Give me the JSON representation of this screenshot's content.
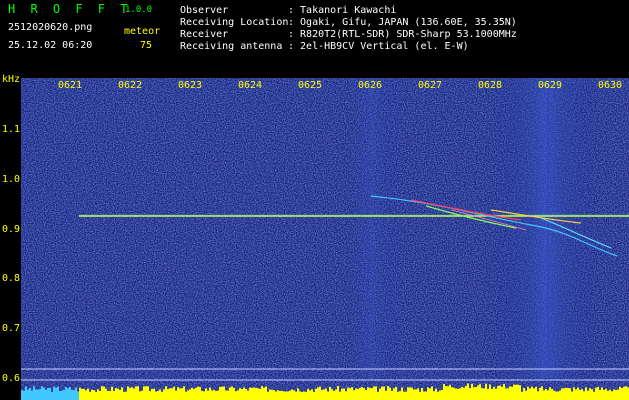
{
  "header": {
    "app_title": "H R O F F T",
    "app_version": "1.0.0",
    "file_name": "2512020620.png",
    "datetime": "25.12.02 06:20",
    "meteor_label": "meteor",
    "meteor_count": "75",
    "info_rows": [
      {
        "label": "Observer",
        "value": ": Takanori Kawachi"
      },
      {
        "label": "Receiving Location",
        "value": ": Ogaki, Gifu, JAPAN (136.60E, 35.35N)"
      },
      {
        "label": "Receiver",
        "value": ": R820T2(RTL-SDR) SDR-Sharp 53.1000MHz"
      },
      {
        "label": "Receiving antenna",
        "value": ": 2el-HB9CV Vertical (el. E-W)"
      }
    ]
  },
  "spectrogram": {
    "y_unit": "kHz",
    "y_ticks": [
      "1.1",
      "1.0",
      "0.9",
      "0.8",
      "0.7",
      "0.6"
    ],
    "x_ticks": [
      "0621",
      "0622",
      "0623",
      "0624",
      "0625",
      "0626",
      "0627",
      "0628",
      "0629",
      "0630"
    ],
    "colors": {
      "background": "#1a2a8a",
      "carrier": "#c8ff40",
      "label": "#ffff00",
      "bottom_bar": "#ffff00",
      "bottom_bar_left": "#40c8ff"
    }
  }
}
